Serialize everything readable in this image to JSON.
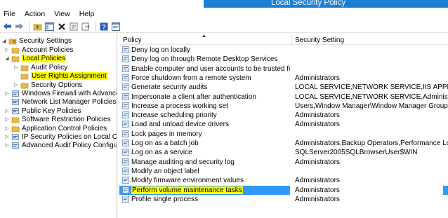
{
  "window": {
    "title": "Local Security Policy"
  },
  "menu": [
    "File",
    "Action",
    "View",
    "Help"
  ],
  "toolbar": [
    "back-icon",
    "forward-icon",
    "up-folder-icon",
    "show-hide-tree-icon",
    "delete-icon",
    "properties-icon",
    "export-list-icon",
    "help-icon",
    "console-icon"
  ],
  "tree": {
    "root": "Security Settings",
    "items": [
      {
        "label": "Account Policies",
        "level": 1,
        "expander": "▷",
        "highlight": false
      },
      {
        "label": "Local Policies",
        "level": 1,
        "expander": "◢",
        "highlight": true
      },
      {
        "label": "Audit Policy",
        "level": 2,
        "expander": "▷",
        "highlight": false
      },
      {
        "label": "User Rights Assignment",
        "level": 2,
        "expander": "",
        "highlight": true
      },
      {
        "label": "Security Options",
        "level": 2,
        "expander": "▷",
        "highlight": false
      },
      {
        "label": "Windows Firewall with Advanced Secu",
        "level": 1,
        "expander": "▷",
        "highlight": false
      },
      {
        "label": "Network List Manager Policies",
        "level": 1,
        "expander": "",
        "highlight": false
      },
      {
        "label": "Public Key Policies",
        "level": 1,
        "expander": "▷",
        "highlight": false
      },
      {
        "label": "Software Restriction Policies",
        "level": 1,
        "expander": "▷",
        "highlight": false
      },
      {
        "label": "Application Control Policies",
        "level": 1,
        "expander": "▷",
        "highlight": false
      },
      {
        "label": "IP Security Policies on Local Compute",
        "level": 1,
        "expander": "▷",
        "highlight": false
      },
      {
        "label": "Advanced Audit Policy Configuration",
        "level": 1,
        "expander": "▷",
        "highlight": false
      }
    ]
  },
  "list": {
    "columns": {
      "policy": "Policy",
      "setting": "Security Setting"
    },
    "rows": [
      {
        "policy": "Deny log on locally",
        "setting": ""
      },
      {
        "policy": "Deny log on through Remote Desktop Services",
        "setting": ""
      },
      {
        "policy": "Enable computer and user accounts to be trusted for delega...",
        "setting": ""
      },
      {
        "policy": "Force shutdown from a remote system",
        "setting": "Administrators"
      },
      {
        "policy": "Generate security audits",
        "setting": "LOCAL SERVICE,NETWORK SERVICE,IIS APPPOOL\\.NET v..."
      },
      {
        "policy": "Impersonate a client after authentication",
        "setting": "LOCAL SERVICE,NETWORK SERVICE,Administrators,IIS_IU..."
      },
      {
        "policy": "Increase a process working set",
        "setting": "Users,Window Manager\\Window Manager Group"
      },
      {
        "policy": "Increase scheduling priority",
        "setting": "Administrators"
      },
      {
        "policy": "Load and unload device drivers",
        "setting": "Administrators"
      },
      {
        "policy": "Lock pages in memory",
        "setting": ""
      },
      {
        "policy": "Log on as a batch job",
        "setting": "Administrators,Backup Operators,Performance Log User..."
      },
      {
        "policy": "Log on as a service",
        "setting": "SQLServer2005SQLBrowserUser$WIN"
      },
      {
        "policy": "Manage auditing and security log",
        "setting": "Administrators"
      },
      {
        "policy": "Modify an object label",
        "setting": ""
      },
      {
        "policy": "Modify firmware environment values",
        "setting": "Administrators"
      },
      {
        "policy": "Perform volume maintenance tasks",
        "setting": "Administrators",
        "selected": true
      },
      {
        "policy": "Profile single process",
        "setting": "Administrators"
      }
    ]
  },
  "colors": {
    "titlebar": "#1e7ed3",
    "selection": "#3399ff",
    "highlight": "#ffff00",
    "folder": "#e8b84a"
  }
}
